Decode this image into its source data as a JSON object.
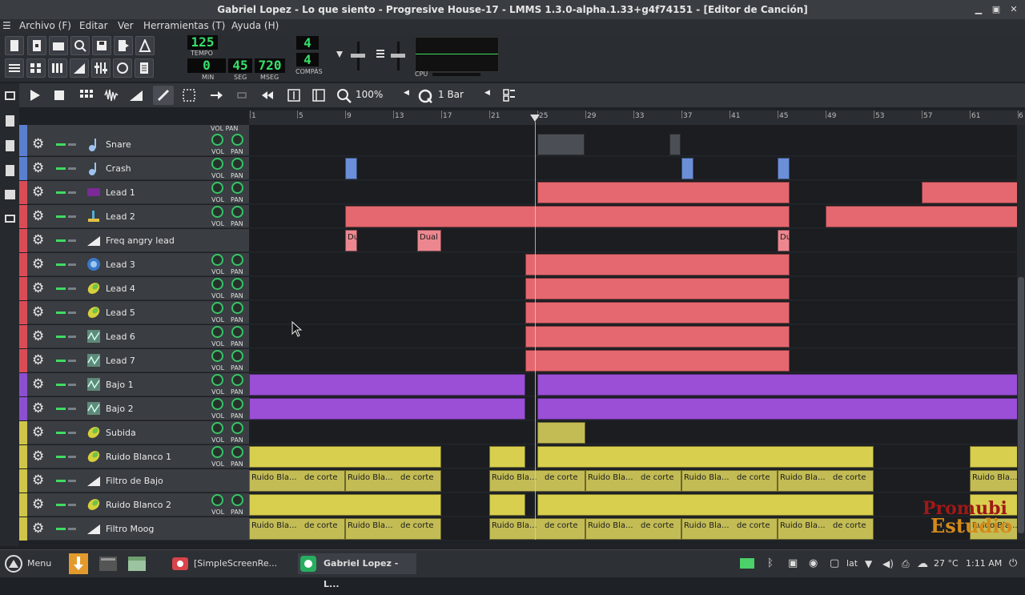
{
  "window": {
    "title": "Gabriel Lopez - Lo que siento - Progresive House-17 - LMMS 1.3.0-alpha.1.33+g4f74151 - [Editor de Canción]"
  },
  "menu": [
    "Archivo (F)",
    "Editar",
    "Ver",
    "Herramientas (T)",
    "Ayuda (H)"
  ],
  "transport": {
    "tempo": "125",
    "tempo_label": "TEMPO",
    "min": "0",
    "sec": "45",
    "msec": "720",
    "min_label": "MIN",
    "sec_label": "SEG",
    "msec_label": "MSEG",
    "sig_num": "4",
    "sig_den": "4",
    "compas_label": "COMPÁS",
    "cpu_label": "CPU"
  },
  "song_toolbar": {
    "zoom": "100%",
    "quantize": "1 Bar"
  },
  "ruler": [
    "1",
    "5",
    "9",
    "13",
    "17",
    "21",
    "25",
    "29",
    "33",
    "37",
    "41",
    "45",
    "49",
    "53",
    "57",
    "61",
    "6"
  ],
  "knob_labels": {
    "vol": "VOL",
    "pan": "PAN"
  },
  "tracks": [
    {
      "name": "Snare",
      "color": "#5a7fd0",
      "icon": "note-icon"
    },
    {
      "name": "Crash",
      "color": "#5a7fd0",
      "icon": "note-icon"
    },
    {
      "name": "Lead 1",
      "color": "#d94c56",
      "icon": "synth-purple-icon"
    },
    {
      "name": "Lead 2",
      "color": "#d94c56",
      "icon": "plant-icon"
    },
    {
      "name": "Freq angry lead",
      "color": "#d94c56",
      "icon": "automation-icon"
    },
    {
      "name": "Lead 3",
      "color": "#d94c56",
      "icon": "circle-synth-icon"
    },
    {
      "name": "Lead 4",
      "color": "#d94c56",
      "icon": "leaf-icon"
    },
    {
      "name": "Lead 5",
      "color": "#d94c56",
      "icon": "leaf-icon"
    },
    {
      "name": "Lead 6",
      "color": "#d94c56",
      "icon": "wave-icon"
    },
    {
      "name": "Lead 7",
      "color": "#d94c56",
      "icon": "wave-icon"
    },
    {
      "name": "Bajo 1",
      "color": "#8b4fd0",
      "icon": "wave-icon"
    },
    {
      "name": "Bajo 2",
      "color": "#8b4fd0",
      "icon": "wave-icon"
    },
    {
      "name": "Subida",
      "color": "#cfc54a",
      "icon": "leaf-icon"
    },
    {
      "name": "Ruido Blanco 1",
      "color": "#cfc54a",
      "icon": "leaf-icon"
    },
    {
      "name": "Filtro de Bajo",
      "color": "#cfc54a",
      "icon": "automation-icon"
    },
    {
      "name": "Ruido Blanco 2",
      "color": "#cfc54a",
      "icon": "leaf-icon"
    },
    {
      "name": "Filtro Moog",
      "color": "#cfc54a",
      "icon": "automation-icon"
    }
  ],
  "clip_labels": {
    "dual_short": "Du",
    "dual": "Dual",
    "ruido_bla": "Ruido Bla...",
    "de_corte": "de corte"
  },
  "watermark": {
    "line1": "Promubi",
    "line2": "Estudio"
  },
  "taskbar": {
    "menu": "Menu",
    "task1": "[SimpleScreenRe...",
    "task2": "Gabriel Lopez - L...",
    "kbd": "lat",
    "temp": "27 °C",
    "clock": "1:11 AM"
  }
}
